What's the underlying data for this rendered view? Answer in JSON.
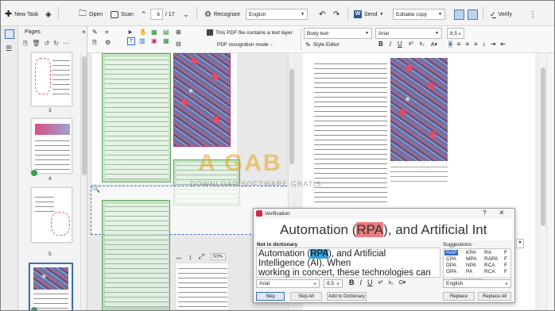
{
  "toolbar": {
    "new_task": "New Task",
    "open": "Open",
    "scan": "Scan",
    "page_current": "6",
    "page_total": "/ 17",
    "recognize": "Recognize",
    "language": "English",
    "send": "Send",
    "mode": "Editable copy",
    "verify": "Verify"
  },
  "row2": {
    "text_layer_msg": "This PDF file contains a text layer",
    "recognition_mode": "PDF recognition mode",
    "style": "Body text",
    "style_editor": "Style Editor",
    "font": "Arial",
    "size": "8,5"
  },
  "pages_panel": {
    "title": "Pages",
    "page_numbers": [
      "3",
      "4",
      "5"
    ]
  },
  "zoom": "50%",
  "watermark": {
    "brand": "A GAB",
    "sub": "DOWNLOAD SOFTWARE GRATIS"
  },
  "verification": {
    "title": "Verification",
    "preview": "Automation (RPA), and Artificial Int",
    "preview_pre": "Automation (",
    "preview_hl": "RPA",
    "preview_post": "), and Artificial Int",
    "not_in_dictionary": "Not in dictionary",
    "editor_line1_pre": "Automation (",
    "editor_line1_hl": "RPA",
    "editor_line1_post": "), and Artificial",
    "editor_line2": "Intelligence (AI). When",
    "editor_line3": "working in concert, these technologies can",
    "font": "Arial",
    "size": "8,5",
    "suggestions_label": "Suggestions:",
    "suggestions": [
      [
        "RAP",
        "KPA",
        "RA",
        "F"
      ],
      [
        "CPA",
        "MPA",
        "RAPA",
        "F"
      ],
      [
        "DPA",
        "NPA",
        "RCA",
        "F"
      ],
      [
        "GPA",
        "PA",
        "RCA",
        "F"
      ]
    ],
    "language": "English",
    "skip": "Skip",
    "skip_all": "Skip All",
    "add_to_dictionary": "Add to Dictionary",
    "replace": "Replace",
    "replace_all": "Replace All"
  }
}
